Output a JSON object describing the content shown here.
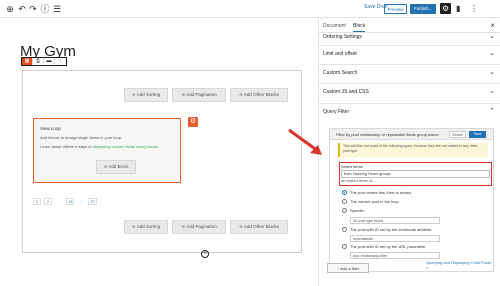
{
  "topbar": {
    "save_draft": "Save Draft",
    "preview": "Preview",
    "publish": "Publish..."
  },
  "page": {
    "title": "My Gym"
  },
  "editor": {
    "add_sorting": "Add Sorting",
    "add_pagination": "Add Pagination",
    "add_other_blocks": "Add Other Blocks",
    "viewloop": {
      "title": "View Loop",
      "text1": "Add blocks to design single items in your loop.",
      "text2_prefix": "Learn about different ways of ",
      "text2_link": "displaying custom fields using blocks.",
      "add_block": "Add Block"
    },
    "pager": [
      "1",
      "2",
      "...",
      "13",
      "...",
      "27"
    ]
  },
  "sidebar": {
    "tabs": [
      "Document",
      "Block"
    ],
    "sections": [
      "Ordering Settings",
      "Limit and offset",
      "Custom Search",
      "Custom JS and CSS",
      "Query Filter"
    ],
    "filter": {
      "header": "Filter by post relationship or repeatable fields group owner",
      "delete": "Delete",
      "save": "Save",
      "note": "This will filter out posts of the following types, because they are not related to any other post type:",
      "select_label": "Select items",
      "select_value": "from Opening Hours groups",
      "select_sub": "as related items of...",
      "options": [
        "The post where this View is shown",
        "The current post in the loop",
        "Specific:",
        "The post with ID set by the shortcode attribute",
        "The post with ID set by the URL parameter"
      ],
      "specific_value": "No post type found",
      "shortcode_value": "wpvrelatedto",
      "url_value": "wpv-relationship-filter",
      "link": "Querying and Displaying Child Posts »"
    },
    "add_filter": "Add a filter"
  },
  "colors": {
    "accent": "#2271b1",
    "views_orange": "#e65c2a",
    "highlight_red": "#d9342b"
  }
}
